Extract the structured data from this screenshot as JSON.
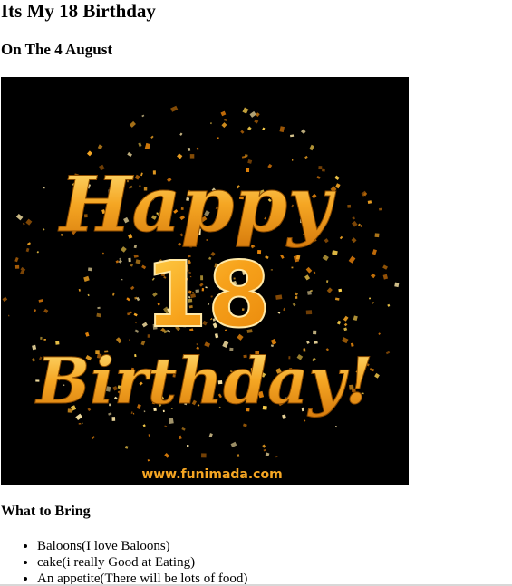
{
  "page": {
    "title": "Its My 18 Birthday",
    "subtitle": "On The 4 August"
  },
  "banner": {
    "word_top": "Happy",
    "number": "18",
    "word_bottom": "Birthday!",
    "watermark": "www.funimada.com",
    "colors": {
      "background": "#000000",
      "gold_light": "#ffd34d",
      "gold_mid": "#f5a623",
      "gold_dark": "#c06a08"
    }
  },
  "bring": {
    "heading": "What to Bring",
    "items": [
      "Baloons(I love Baloons)",
      "cake(i really Good at Eating)",
      "An appetite(There will be lots of food)"
    ]
  }
}
